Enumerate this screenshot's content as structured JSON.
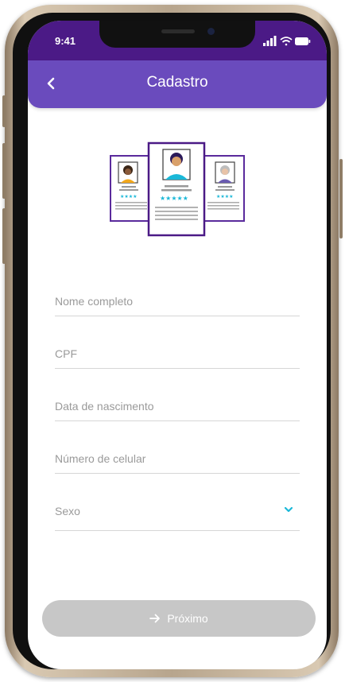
{
  "status_bar": {
    "time": "9:41"
  },
  "header": {
    "title": "Cadastro",
    "back_icon": "chevron-left-icon"
  },
  "form": {
    "full_name_placeholder": "Nome completo",
    "cpf_placeholder": "CPF",
    "birthdate_placeholder": "Data de nascimento",
    "phone_placeholder": "Número de celular",
    "sex_label": "Sexo"
  },
  "actions": {
    "next_label": "Próximo",
    "next_icon": "arrow-right-icon"
  },
  "colors": {
    "status_bar": "#4b1a86",
    "header": "#6a4bbd",
    "accent": "#1ab8d8",
    "button_disabled": "#c7c7c7"
  }
}
